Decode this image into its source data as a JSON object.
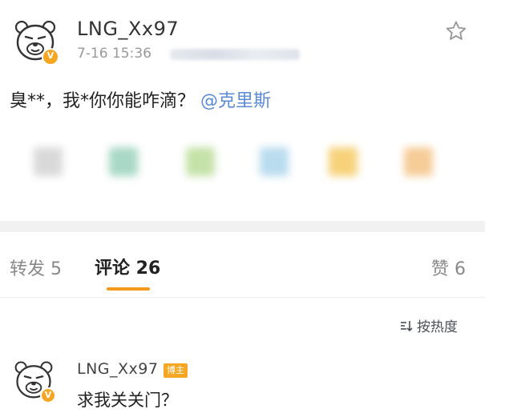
{
  "post": {
    "username": "LNG_Xx97",
    "timestamp": "7-16 15:36",
    "text": "臭**，我*你你能咋滴？",
    "mention": "@克里斯"
  },
  "tabs": {
    "repost": "转发 5",
    "comments": "评论 26",
    "likes": "赞 6"
  },
  "sort": {
    "label": "按热度",
    "icon": "sort-icon"
  },
  "comment": {
    "username": "LNG_Xx97",
    "badge": "博主",
    "text": "求我关关门？"
  },
  "colors": {
    "accent": "#f39a1a",
    "mention": "#5b8bd6",
    "verified": "#f5a623"
  }
}
